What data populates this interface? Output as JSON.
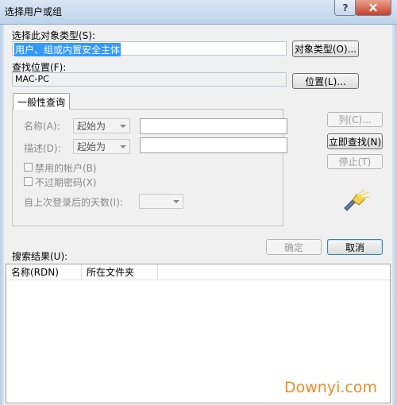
{
  "window": {
    "title": "选择用户或组",
    "help_glyph": "?",
    "close_glyph": "✕"
  },
  "object_type": {
    "label": "选择此对象类型(S):",
    "value": "用户、组或内置安全主体",
    "button": "对象类型(O)..."
  },
  "location": {
    "label": "查找位置(F):",
    "value": "MAC-PC",
    "button": "位置(L)..."
  },
  "tab": {
    "label": "一般性查询"
  },
  "query": {
    "name_label": "名称(A):",
    "name_mode": "起始为",
    "name_value": "",
    "desc_label": "描述(D):",
    "desc_mode": "起始为",
    "desc_value": "",
    "disabled_accounts": "禁用的帐户(B)",
    "non_expiring_pw": "不过期密码(X)",
    "days_since_login_label": "自上次登录后的天数(I):",
    "days_since_login_value": ""
  },
  "side_buttons": {
    "columns": "列(C)...",
    "find_now": "立即查找(N)",
    "stop": "停止(T)"
  },
  "footer_buttons": {
    "ok": "确定",
    "cancel": "取消"
  },
  "results": {
    "label": "搜索结果(U):",
    "columns": [
      "名称(RDN)",
      "所在文件夹"
    ]
  },
  "watermark": "Downyi.com",
  "icons": {
    "search": "search-flashlight-icon"
  }
}
